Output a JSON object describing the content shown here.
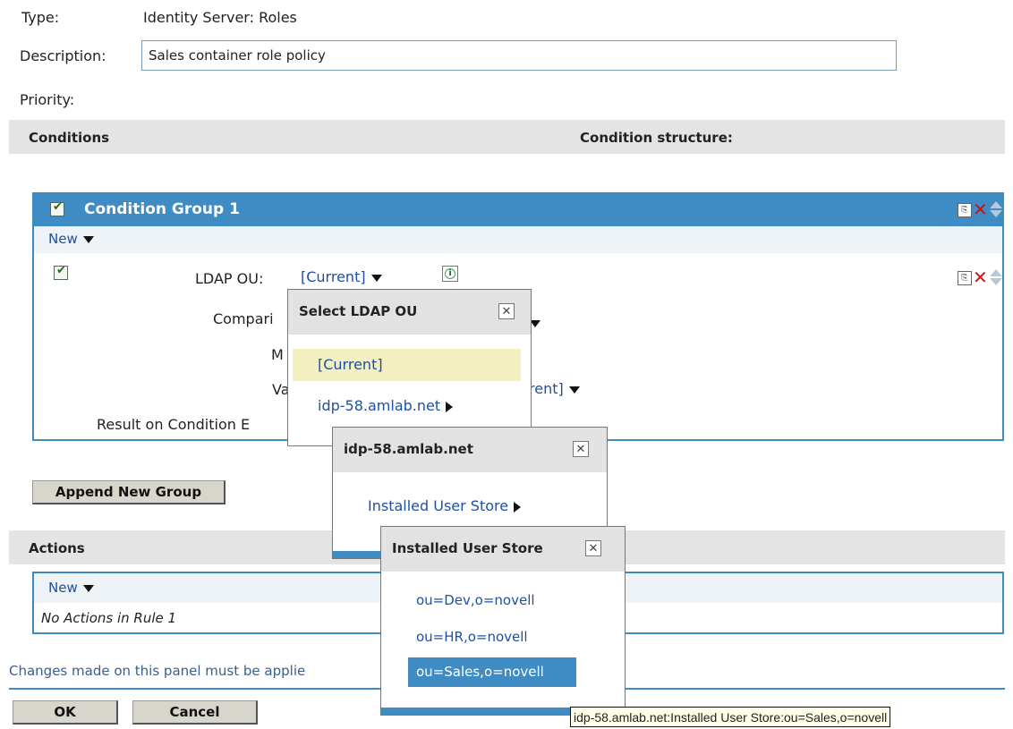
{
  "form": {
    "type_label": "Type:",
    "type_value": "Identity Server: Roles",
    "description_label": "Description:",
    "description_value": "Sales container role policy",
    "priority_label": "Priority:"
  },
  "conditions_section": {
    "title": "Conditions",
    "structure_label": "Condition structure:"
  },
  "condition_group": {
    "title": "Condition Group 1",
    "new_menu": "New",
    "ldap_ou_label": "LDAP OU:",
    "ldap_ou_value": "[Current]",
    "comparison_label": "Compari",
    "mode_label": "M",
    "value_label": "Va",
    "value_value": "rent]",
    "result_label": "Result on Condition E"
  },
  "append_button": "Append New Group",
  "actions_section": {
    "title": "Actions",
    "new_menu": "New",
    "empty_text": "No Actions in Rule 1"
  },
  "footer": {
    "note": "Changes made on this panel must be applie",
    "ok_button": "OK",
    "cancel_button": "Cancel"
  },
  "popup_ldap": {
    "title": "Select LDAP OU",
    "items": [
      "[Current]",
      "idp-58.amlab.net"
    ]
  },
  "popup_host": {
    "title": "idp-58.amlab.net",
    "items": [
      "Installed User Store"
    ]
  },
  "popup_store": {
    "title": "Installed User Store",
    "items": [
      "ou=Dev,o=novell",
      "ou=HR,o=novell",
      "ou=Sales,o=novell"
    ]
  },
  "tooltip": "idp-58.amlab.net:Installed User Store:ou=Sales,o=novell",
  "icons": {
    "checkbox": "check-icon",
    "copy": "copy-icon",
    "delete": "delete-icon",
    "move": "up-down-icon",
    "info": "info-icon",
    "close": "close-icon"
  },
  "colors": {
    "accent": "#3f8bc3",
    "link": "#1f4fa3",
    "highlight": "#f3f0c0",
    "selected": "#3f8bc3"
  }
}
